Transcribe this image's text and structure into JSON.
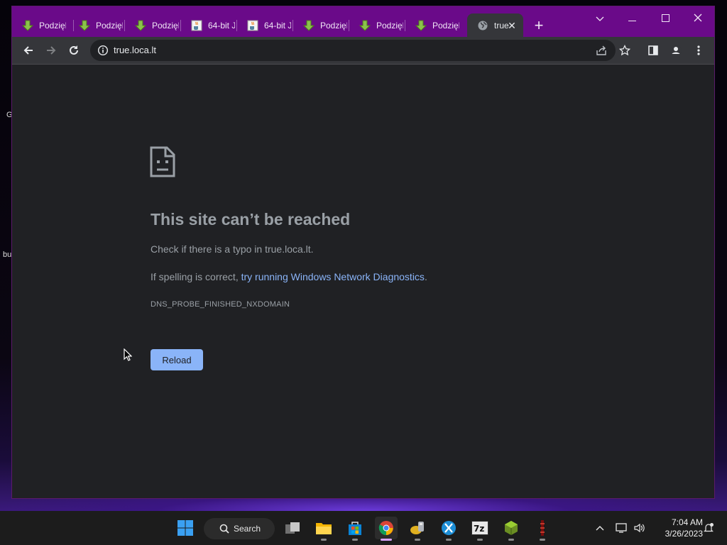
{
  "browser": {
    "tabs": [
      {
        "title": "Podzięk",
        "icon": "download-arrow-icon"
      },
      {
        "title": "Podzięk",
        "icon": "download-arrow-icon"
      },
      {
        "title": "Podzięk",
        "icon": "download-arrow-icon"
      },
      {
        "title": "64-bit J",
        "icon": "java-cup-icon"
      },
      {
        "title": "64-bit J",
        "icon": "java-cup-icon"
      },
      {
        "title": "Podzięk",
        "icon": "download-arrow-icon"
      },
      {
        "title": "Podzięk",
        "icon": "download-arrow-icon"
      },
      {
        "title": "Podzięk",
        "icon": "download-arrow-icon"
      },
      {
        "title": "true",
        "icon": "globe-icon",
        "active": true
      }
    ],
    "address": "true.loca.lt",
    "colors": {
      "tabstrip": "#6a0a89",
      "toolbar": "#35363a",
      "page": "#202124",
      "link": "#8ab4f8"
    }
  },
  "error_page": {
    "title": "This site can’t be reached",
    "check_prefix": "Check if there is a typo in ",
    "check_host": "true.loca.lt",
    "check_suffix": ".",
    "spelling_prefix": "If spelling is correct, ",
    "spelling_link": "try running Windows Network Diagnostics",
    "spelling_suffix": ".",
    "error_code": "DNS_PROBE_FINISHED_NXDOMAIN",
    "reload_label": "Reload"
  },
  "taskbar": {
    "search_label": "Search",
    "apps": [
      "windows-start-icon",
      "task-view-icon",
      "file-explorer-icon",
      "microsoft-store-icon",
      "chrome-icon",
      "app-icon",
      "xcode-like-icon",
      "7zip-icon",
      "minecraft-block-icon",
      "red-app-icon"
    ],
    "clock_time": "7:04 AM",
    "clock_date": "3/26/2023"
  },
  "desktop_fragments": [
    "G",
    "bu"
  ]
}
